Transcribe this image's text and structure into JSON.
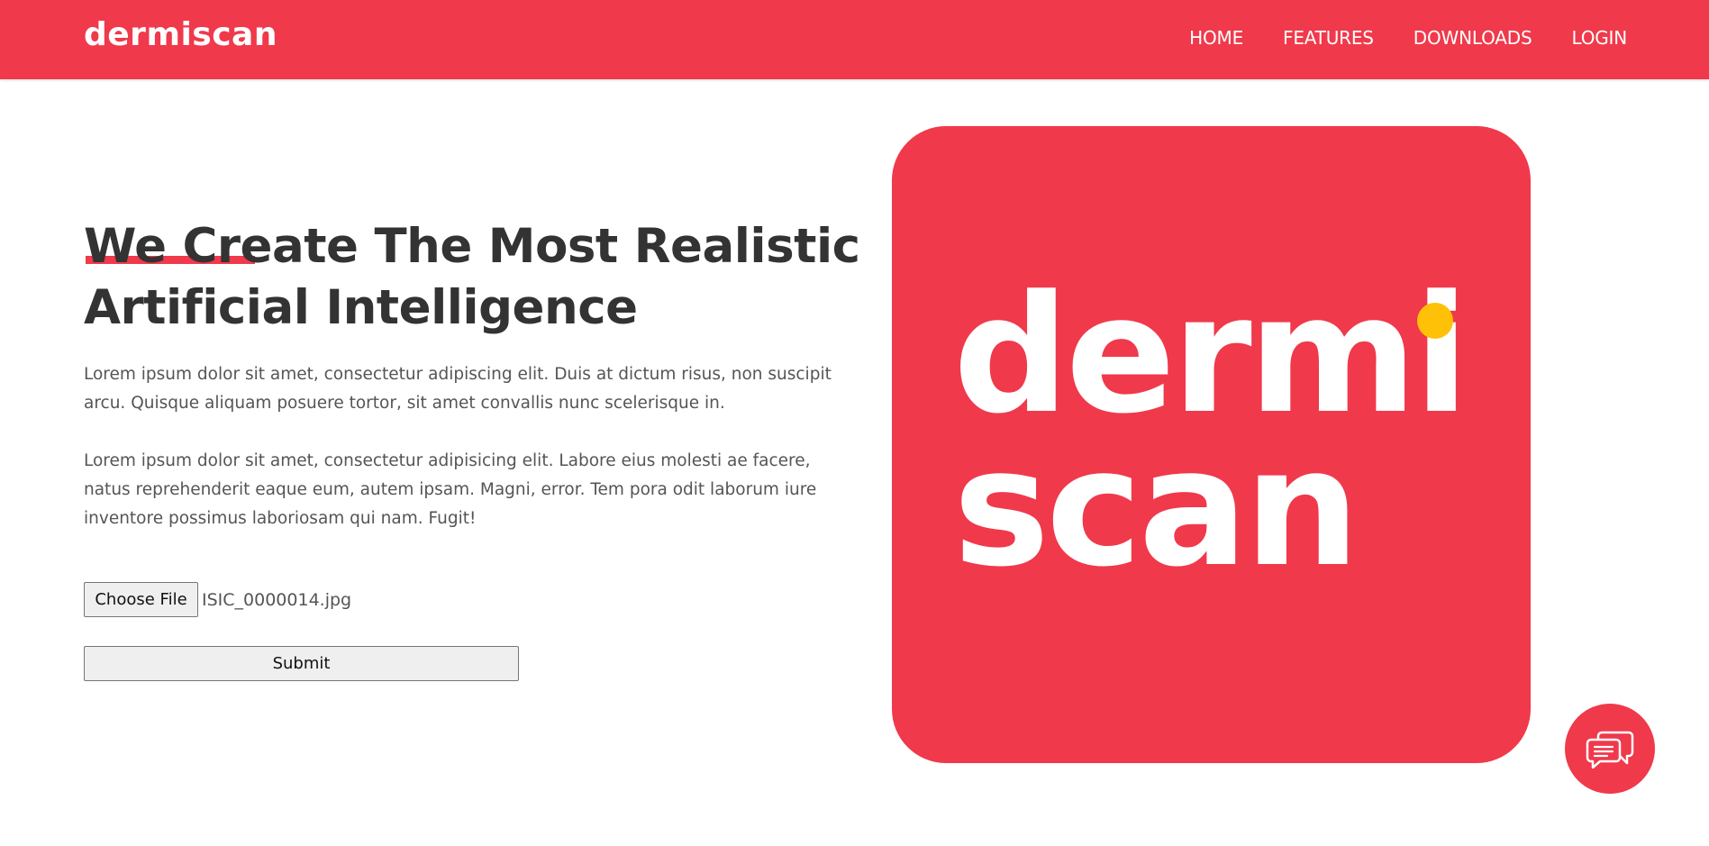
{
  "brand": "dermiscan",
  "nav": {
    "items": [
      {
        "label": "HOME"
      },
      {
        "label": "FEATURES"
      },
      {
        "label": "DOWNLOADS"
      },
      {
        "label": "LOGIN"
      }
    ]
  },
  "hero": {
    "headline_line1": "We Create The Most Realistic",
    "headline_line2": "Artificial Intelligence",
    "paragraph1": "Lorem ipsum dolor sit amet, consectetur adipiscing elit. Duis at dictum risus, non suscipit arcu. Quisque aliquam posuere tortor, sit amet convallis nunc scelerisque in.",
    "paragraph2": "Lorem ipsum dolor sit amet, consectetur adipisicing elit. Labore eius molesti ae facere, natus reprehenderit eaque eum, autem ipsam. Magni, error. Tem pora odit laborum iure inventore possimus laboriosam qui nam. Fugit!"
  },
  "upload": {
    "choose_label": "Choose File",
    "file_name": "ISIC_0000014.jpg",
    "submit_label": "Submit"
  },
  "logo": {
    "line1": "dermi",
    "line2": "scan"
  },
  "icons": {
    "chat": "chat-bubbles-icon"
  },
  "colors": {
    "brand_red": "#f0394b",
    "accent_yellow": "#ffc107",
    "text_dark": "#333333"
  }
}
